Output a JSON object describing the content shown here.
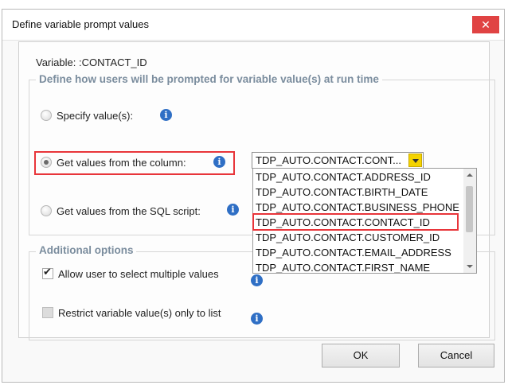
{
  "window": {
    "title": "Define variable prompt values",
    "close_glyph": "✕"
  },
  "variable_label": "Variable:  :CONTACT_ID",
  "prompt_group": {
    "title": "Define how users will be prompted for variable value(s) at run time",
    "options": [
      {
        "label": "Specify value(s):",
        "selected": false
      },
      {
        "label": "Get values from the column:",
        "selected": true
      },
      {
        "label": "Get values from the SQL script:",
        "selected": false
      }
    ]
  },
  "column_combo": {
    "value": "TDP_AUTO.CONTACT.CONT...",
    "list": [
      "TDP_AUTO.CONTACT.ADDRESS_ID",
      "TDP_AUTO.CONTACT.BIRTH_DATE",
      "TDP_AUTO.CONTACT.BUSINESS_PHONE",
      "TDP_AUTO.CONTACT.CONTACT_ID",
      "TDP_AUTO.CONTACT.CUSTOMER_ID",
      "TDP_AUTO.CONTACT.EMAIL_ADDRESS",
      "TDP_AUTO.CONTACT.FIRST_NAME"
    ],
    "highlighted_item": "TDP_AUTO.CONTACT.CONTACT_ID"
  },
  "additional_group": {
    "title": "Additional options",
    "options": [
      {
        "label": "Allow user to select multiple values",
        "checked": true,
        "enabled": true
      },
      {
        "label": "Restrict variable value(s) only to list",
        "checked": false,
        "enabled": false
      }
    ]
  },
  "info_glyph": "i",
  "buttons": {
    "ok": "OK",
    "cancel": "Cancel"
  },
  "colors": {
    "highlight": "#e8353a",
    "info": "#2f6fc5",
    "close": "#e04343",
    "combo_arrow": "#f4d300"
  }
}
